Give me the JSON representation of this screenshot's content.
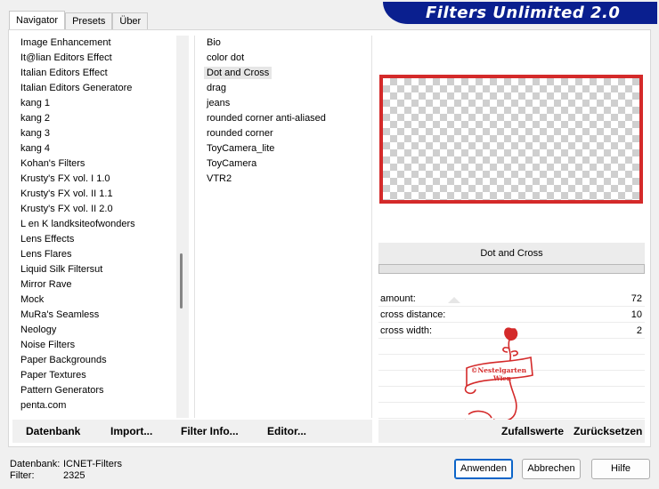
{
  "app": {
    "title": "Filters Unlimited 2.0"
  },
  "tabs": [
    {
      "label": "Navigator",
      "active": true
    },
    {
      "label": "Presets",
      "active": false
    },
    {
      "label": "Über",
      "active": false
    }
  ],
  "categories": [
    "Image Enhancement",
    "It@lian Editors Effect",
    "Italian Editors Effect",
    "Italian Editors Generatore",
    "kang 1",
    "kang 2",
    "kang 3",
    "kang 4",
    "Kohan's Filters",
    "Krusty's FX vol. I 1.0",
    "Krusty's FX vol. II 1.1",
    "Krusty's FX vol. II 2.0",
    "L en K landksiteofwonders",
    "Lens Effects",
    "Lens Flares",
    "Liquid Silk Filtersut",
    "Mirror Rave",
    "Mock",
    "MuRa's Seamless",
    "Neology",
    "Noise Filters",
    "Paper Backgrounds",
    "Paper Textures",
    "Pattern Generators",
    "penta.com"
  ],
  "filters": [
    {
      "label": "Bio",
      "selected": false
    },
    {
      "label": "color dot",
      "selected": false
    },
    {
      "label": "Dot and Cross",
      "selected": true
    },
    {
      "label": "drag",
      "selected": false
    },
    {
      "label": "jeans",
      "selected": false
    },
    {
      "label": "rounded corner anti-aliased",
      "selected": false
    },
    {
      "label": "rounded corner",
      "selected": false
    },
    {
      "label": "ToyCamera_lite",
      "selected": false
    },
    {
      "label": "ToyCamera",
      "selected": false
    },
    {
      "label": "VTR2",
      "selected": false
    }
  ],
  "preview": {
    "filter_name": "Dot and Cross",
    "border_color": "#d42a2a"
  },
  "params": [
    {
      "label": "amount:",
      "value": "72"
    },
    {
      "label": "cross distance:",
      "value": "10"
    },
    {
      "label": "cross width:",
      "value": "2"
    }
  ],
  "toolbar": {
    "database": "Datenbank",
    "import": "Import...",
    "filter_info": "Filter Info...",
    "editor": "Editor...",
    "random": "Zufallswerte",
    "reset": "Zurücksetzen"
  },
  "status": {
    "db_label": "Datenbank:",
    "db_value": "ICNET-Filters",
    "filter_label": "Filter:",
    "filter_value": "2325"
  },
  "buttons": {
    "apply": "Anwenden",
    "cancel": "Abbrechen",
    "help": "Hilfe"
  },
  "watermark": {
    "line1": "©Nestelgarten",
    "line2": "Wien"
  },
  "colors": {
    "banner": "#0a1f8f",
    "accent": "#d42a2a",
    "default_button_border": "#0a64c8"
  }
}
